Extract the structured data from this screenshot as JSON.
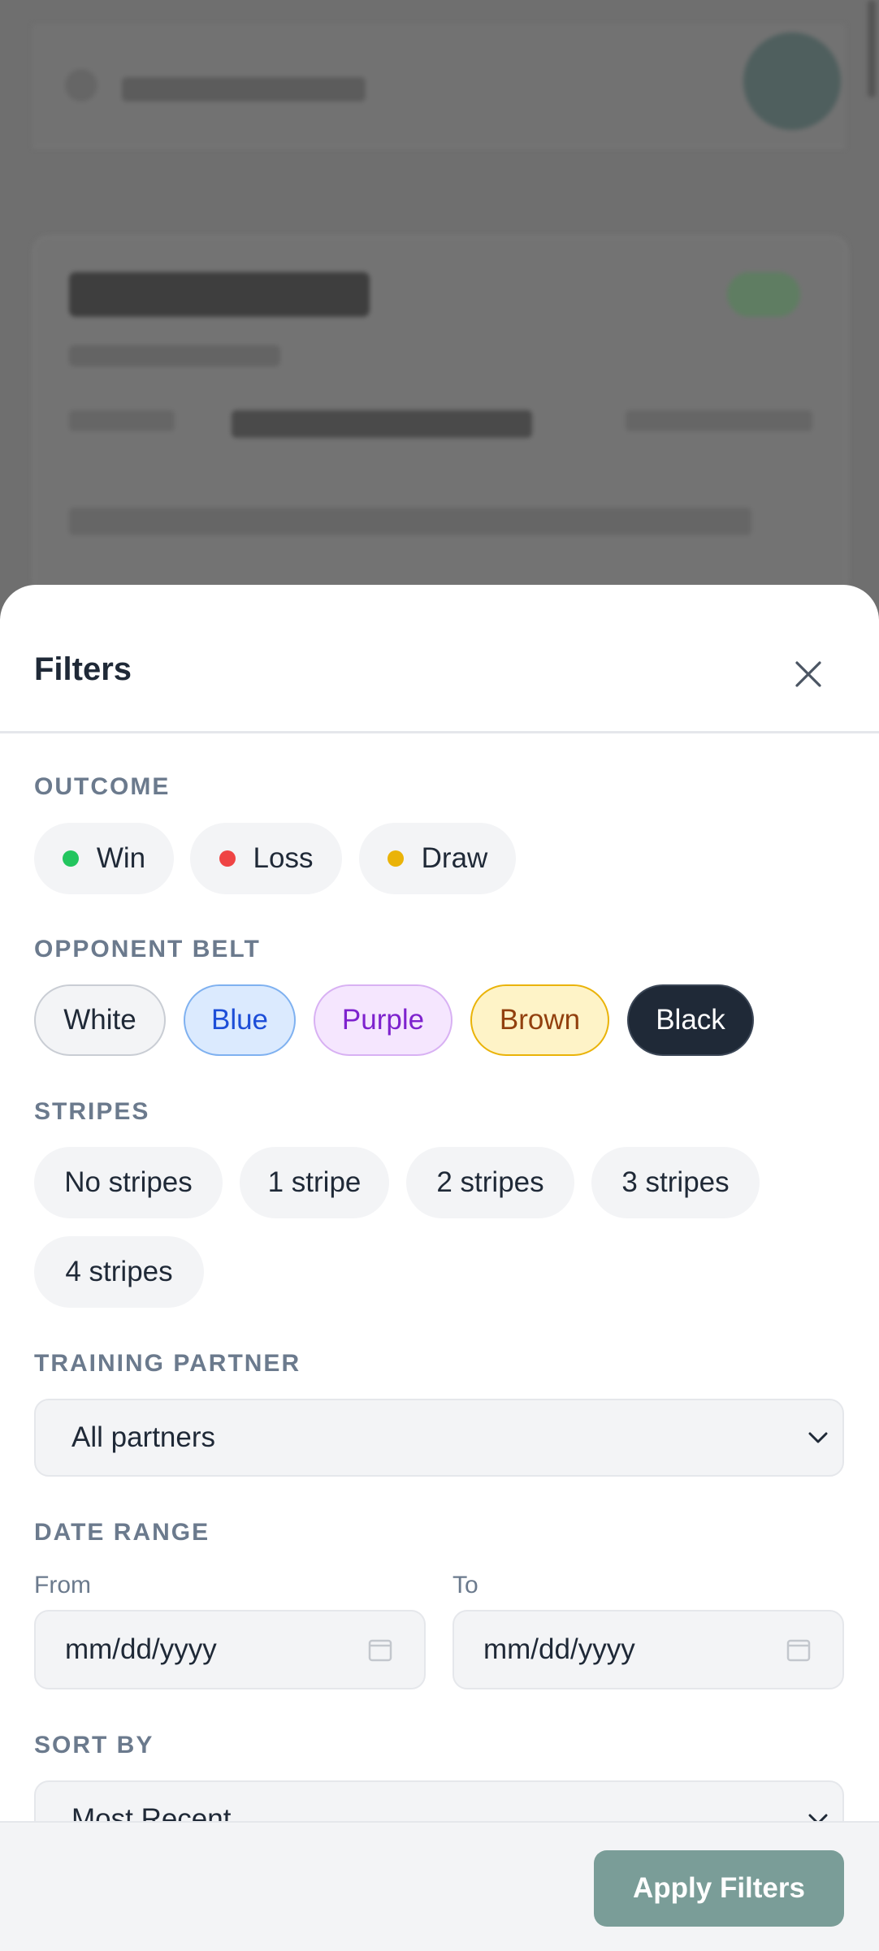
{
  "sheet": {
    "title": "Filters",
    "close_icon": "close-icon"
  },
  "outcome": {
    "label": "OUTCOME",
    "options": [
      {
        "label": "Win",
        "color": "#22c55e"
      },
      {
        "label": "Loss",
        "color": "#ef4444"
      },
      {
        "label": "Draw",
        "color": "#eab308"
      }
    ]
  },
  "belt": {
    "label": "OPPONENT BELT",
    "options": [
      "White",
      "Blue",
      "Purple",
      "Brown",
      "Black"
    ]
  },
  "stripes": {
    "label": "STRIPES",
    "options": [
      "No stripes",
      "1 stripe",
      "2 stripes",
      "3 stripes",
      "4 stripes"
    ]
  },
  "partner": {
    "label": "TRAINING PARTNER",
    "selected": "All partners"
  },
  "date_range": {
    "label": "DATE RANGE",
    "from_label": "From",
    "to_label": "To",
    "from_placeholder": "mm/dd/yyyy",
    "to_placeholder": "mm/dd/yyyy"
  },
  "sort": {
    "label": "SORT BY",
    "selected": "Most Recent"
  },
  "footer": {
    "apply_label": "Apply Filters"
  },
  "colors": {
    "accent": "#7a9d98",
    "dark": "#1f2937",
    "muted": "#6b7a8d"
  }
}
